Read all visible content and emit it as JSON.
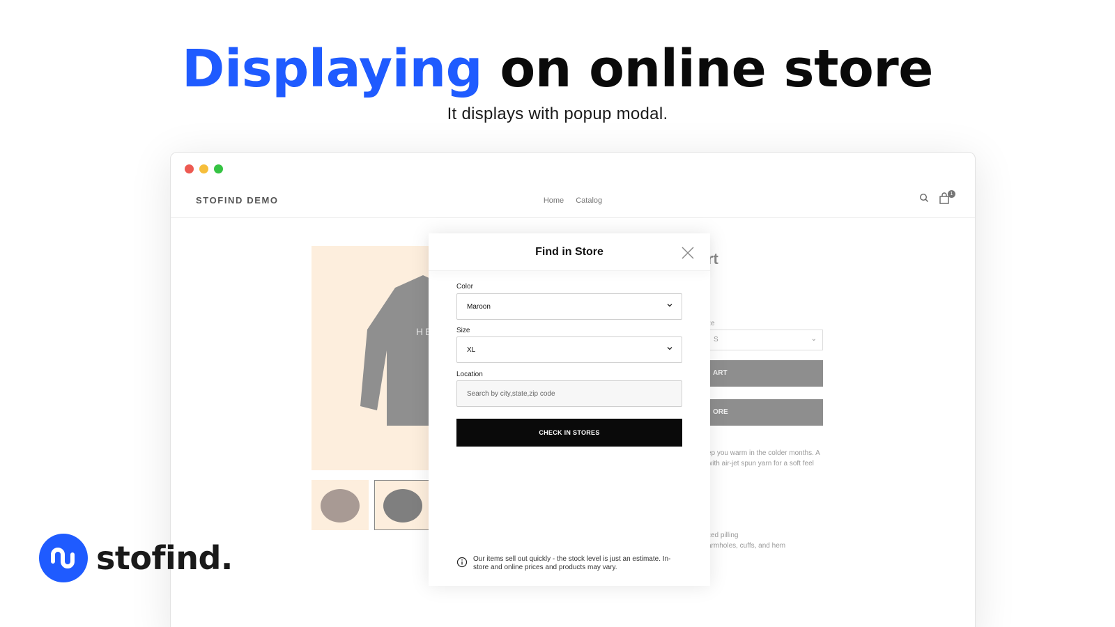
{
  "headline": {
    "accent": "Displaying",
    "rest": " on online store"
  },
  "subheadline": "It displays with popup modal.",
  "browser": {
    "dots": [
      "#ed5a52",
      "#f6be3b",
      "#35c343"
    ]
  },
  "store": {
    "brand": "STOFIND DEMO",
    "nav": [
      "Home",
      "Catalog"
    ],
    "cart_count": "1"
  },
  "product": {
    "print_text": "HEL",
    "title_fragment": "rt",
    "size_label": "ze",
    "size_value": "S",
    "button_1": "ART",
    "button_2": "ORE",
    "desc_lines": [
      "ep you warm in the colder months. A",
      "with air-jet spun yarn for a soft feel"
    ],
    "feature_lines": [
      "ced pilling",
      "armholes, cuffs, and hem"
    ]
  },
  "modal": {
    "title": "Find in Store",
    "color_label": "Color",
    "color_value": "Maroon",
    "size_label": "Size",
    "size_value": "XL",
    "location_label": "Location",
    "location_placeholder": "Search by city,state,zip code",
    "check_button": "CHECK IN STORES",
    "notice_line1": "Our items sell out quickly - the stock level is just an estimate. In-",
    "notice_line2": "store and online prices and products may vary."
  },
  "logo": {
    "text": "stofind."
  },
  "colors": {
    "accent": "#1f5bff",
    "button": "#0a0a0a"
  }
}
